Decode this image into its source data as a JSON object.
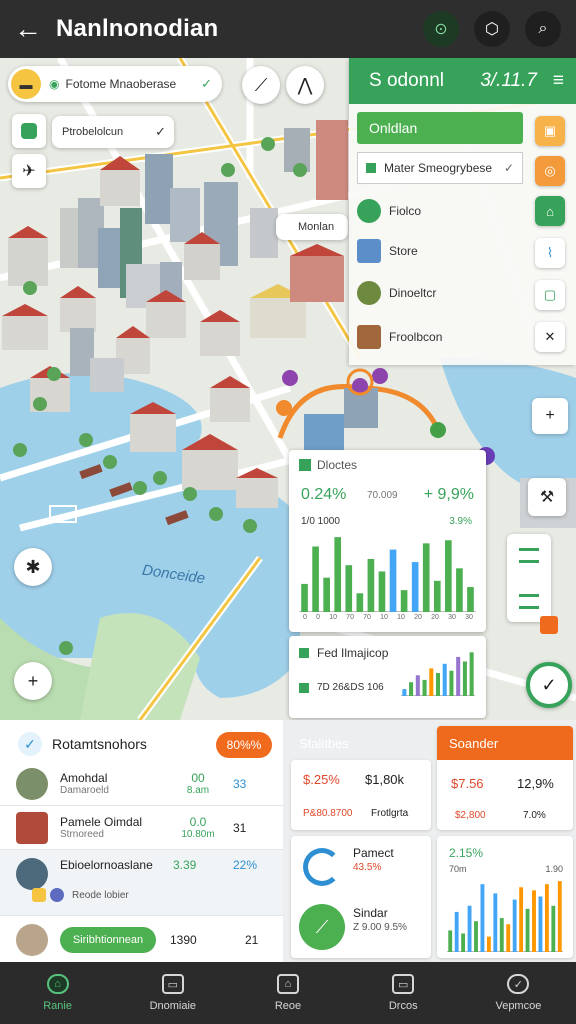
{
  "header": {
    "back_icon": "←",
    "title": "Nanlnonodian",
    "icon1": "⊙",
    "icon2": "⬡",
    "icon3": "⌕"
  },
  "map": {
    "search_chip": "Fotome Mnaoberase",
    "filter_chip": "Ptrobelolcun",
    "marker_label": "Monlan",
    "water_label": "Donceide",
    "layer_panel": {
      "title": "S odonnl",
      "value": "3/.11.7",
      "menu_icon": "≡",
      "green_item": "Onldlan",
      "select": "Mater Smeogrybese",
      "rows": [
        "Fiolco",
        "Store",
        "Dinoeltcr",
        "Froolbcon"
      ]
    },
    "stat_card": {
      "title": "Dloctes",
      "left_value": "0.24%",
      "mid_value": "70.009",
      "right_value": "+ 9,9%",
      "sub_left": "1/0 1000",
      "sub_right": "3.9%",
      "axis": [
        "0",
        "0",
        "10",
        "70",
        "70",
        "10",
        "10",
        "20",
        "20",
        "30",
        "30"
      ],
      "chart_data": {
        "type": "bar",
        "values": [
          18,
          42,
          22,
          48,
          30,
          12,
          34,
          26,
          40,
          14,
          32,
          44,
          20,
          46,
          28,
          16
        ],
        "colors": [
          "#4caf50",
          "#4caf50",
          "#4caf50",
          "#4caf50",
          "#4caf50",
          "#4caf50",
          "#4caf50",
          "#4caf50",
          "#42a5f5",
          "#4caf50",
          "#42a5f5",
          "#4caf50",
          "#4caf50",
          "#4caf50",
          "#4caf50",
          "#4caf50"
        ]
      }
    },
    "stat_card2": {
      "title": "Fed Ilmajicop",
      "sub": "7D 26&DS 106",
      "chart_data": {
        "type": "bar",
        "values": [
          6,
          12,
          18,
          14,
          24,
          20,
          28,
          22,
          34,
          30,
          38
        ],
        "colors": [
          "#42a5f5",
          "#4caf50",
          "#9575cd",
          "#4caf50",
          "#ff9800",
          "#4caf50",
          "#42a5f5",
          "#4caf50",
          "#9575cd",
          "#4caf50",
          "#4caf50"
        ]
      }
    },
    "zoom_in": "+",
    "zoom_out": "+",
    "compass": "✱",
    "hammer": "⚒",
    "accent_green": "#37a35a",
    "accent_orange": "#f06a1e"
  },
  "left_panel": {
    "title": "Rotamtsnohors",
    "badge": "80%%",
    "rows": [
      {
        "name": "Amohdal",
        "sub": "Damaroeld",
        "v1": "00",
        "v1sub": "8.am",
        "v2": "33"
      },
      {
        "name": "Pamele Oimdal",
        "sub": "Strnoreed",
        "v1": "0.0",
        "v1sub": "10.80m",
        "v2": "31"
      },
      {
        "name": "Ebioelornoaslane",
        "sub": "",
        "v1": "3.39",
        "v1sub": "",
        "v2": "22%"
      },
      {
        "name": "Reode lobier",
        "sub": "",
        "v1": "",
        "v1sub": "",
        "v2": ""
      },
      {
        "name": "Siribhtionnean",
        "sub": "",
        "v1": "1390",
        "v1sub": "",
        "v2": "21"
      }
    ]
  },
  "right_panel": {
    "stat_title": "Stalitbes",
    "stat_value1": "$.25%",
    "stat_value2": "$1,80k",
    "stat_sub1": "P&80.8700",
    "stat_sub2": "Frotlgrta",
    "orange_title": "Soander",
    "orange_value1": "$7.56",
    "orange_value2": "12,9%",
    "orange_sub1": "$2,800",
    "orange_sub2": "7.0%",
    "donut_title": "Pamect",
    "donut_value": "43.5%",
    "bar_title": "2.15%",
    "bar_sub1": "70m",
    "bar_sub2": "1.90",
    "progress_title": "Sindar",
    "progress_sub": "Z 9.00 9.5%",
    "chart_data": {
      "type": "bar",
      "values": [
        14,
        26,
        12,
        30,
        20,
        44,
        10,
        38,
        22,
        18,
        34,
        42,
        28,
        40,
        36,
        44,
        30,
        46
      ],
      "colors": [
        "#4caf50",
        "#42a5f5",
        "#4caf50",
        "#42a5f5",
        "#4caf50",
        "#42a5f5",
        "#ff9800",
        "#42a5f5",
        "#4caf50",
        "#ff9800",
        "#42a5f5",
        "#ff9800",
        "#4caf50",
        "#ff9800",
        "#42a5f5",
        "#ff9800",
        "#4caf50",
        "#ff9800"
      ]
    }
  },
  "nav": [
    {
      "label": "Ranie",
      "icon": "⌂"
    },
    {
      "label": "Dnomiaie",
      "icon": "▭"
    },
    {
      "label": "Reoe",
      "icon": "⌂"
    },
    {
      "label": "Drcos",
      "icon": "▭"
    },
    {
      "label": "Vepmcoe",
      "icon": "✓"
    }
  ]
}
